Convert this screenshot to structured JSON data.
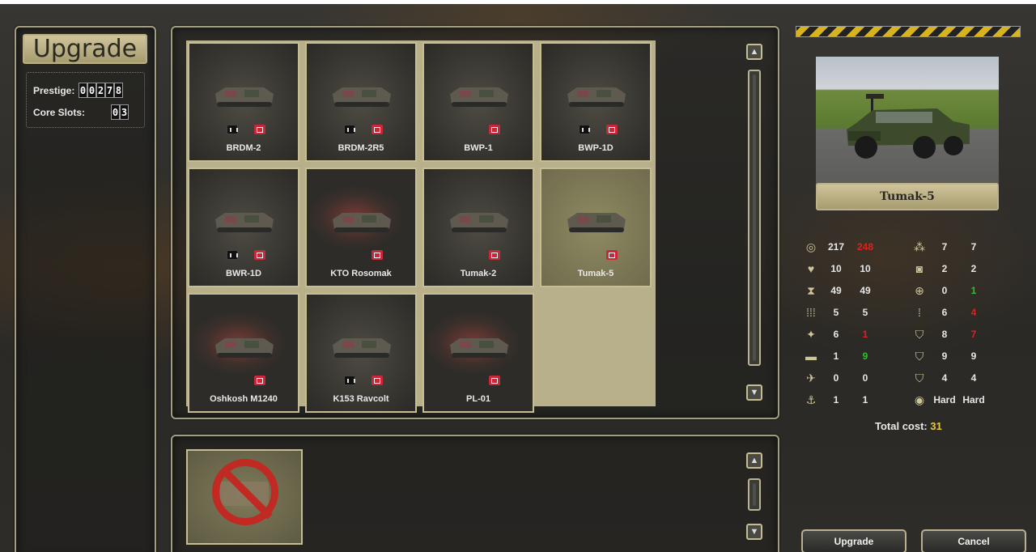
{
  "title": "Upgrade",
  "prestige": {
    "label": "Prestige:",
    "digits": [
      "0",
      "0",
      "2",
      "7",
      "8"
    ]
  },
  "core_slots": {
    "label": "Core Slots:",
    "digits": [
      "0",
      "3"
    ]
  },
  "units": [
    {
      "name": "BRDM-2",
      "binoculars": true,
      "selected": false,
      "glow": false
    },
    {
      "name": "BRDM-2R5",
      "binoculars": true,
      "selected": false,
      "glow": false
    },
    {
      "name": "BWP-1",
      "binoculars": false,
      "selected": false,
      "glow": false
    },
    {
      "name": "BWP-1D",
      "binoculars": true,
      "selected": false,
      "glow": false
    },
    {
      "name": "BWR-1D",
      "binoculars": true,
      "selected": false,
      "glow": false
    },
    {
      "name": "KTO Rosomak",
      "binoculars": false,
      "selected": false,
      "glow": true
    },
    {
      "name": "Tumak-2",
      "binoculars": false,
      "selected": false,
      "glow": false
    },
    {
      "name": "Tumak-5",
      "binoculars": false,
      "selected": true,
      "glow": false
    },
    {
      "name": "Oshkosh M1240",
      "binoculars": false,
      "selected": false,
      "glow": true
    },
    {
      "name": "K153 Ravcolt",
      "binoculars": true,
      "selected": false,
      "glow": false
    },
    {
      "name": "PL-01",
      "binoculars": false,
      "selected": false,
      "glow": true
    }
  ],
  "selected_unit": {
    "name": "Tumak-5"
  },
  "stats_left": [
    {
      "icon": "coins-icon",
      "glyph": "◎",
      "a": "217",
      "b": "248",
      "b_color": "red"
    },
    {
      "icon": "heart-icon",
      "glyph": "♥",
      "a": "10",
      "b": "10",
      "b_color": ""
    },
    {
      "icon": "hourglass-icon",
      "glyph": "⧗",
      "a": "49",
      "b": "49",
      "b_color": ""
    },
    {
      "icon": "ammo-icon",
      "glyph": "⁞⁞⁞",
      "a": "5",
      "b": "5",
      "b_color": ""
    },
    {
      "icon": "soft-attack-icon",
      "glyph": "✦",
      "a": "6",
      "b": "1",
      "b_color": "red"
    },
    {
      "icon": "hard-attack-icon",
      "glyph": "▬",
      "a": "1",
      "b": "9",
      "b_color": "green"
    },
    {
      "icon": "air-attack-icon",
      "glyph": "✈",
      "a": "0",
      "b": "0",
      "b_color": ""
    },
    {
      "icon": "naval-attack-icon",
      "glyph": "⚓",
      "a": "1",
      "b": "1",
      "b_color": ""
    }
  ],
  "stats_right": [
    {
      "icon": "movement-icon",
      "glyph": "⁂",
      "a": "7",
      "b": "7",
      "b_color": ""
    },
    {
      "icon": "spotting-icon",
      "glyph": "◙",
      "a": "2",
      "b": "2",
      "b_color": ""
    },
    {
      "icon": "range-icon",
      "glyph": "⊕",
      "a": "0",
      "b": "1",
      "b_color": "green"
    },
    {
      "icon": "initiative-icon",
      "glyph": "⁞",
      "a": "6",
      "b": "4",
      "b_color": "red"
    },
    {
      "icon": "ground-defense-icon",
      "glyph": "⛉",
      "a": "8",
      "b": "7",
      "b_color": "red"
    },
    {
      "icon": "air-defense-icon",
      "glyph": "⛉",
      "a": "9",
      "b": "9",
      "b_color": ""
    },
    {
      "icon": "close-defense-icon",
      "glyph": "⛉",
      "a": "4",
      "b": "4",
      "b_color": ""
    },
    {
      "icon": "target-type-icon",
      "glyph": "◉",
      "a": "Hard",
      "b": "Hard",
      "b_color": ""
    }
  ],
  "total_cost": {
    "label": "Total cost:",
    "value": "31"
  },
  "buttons": {
    "upgrade": "Upgrade",
    "cancel": "Cancel"
  },
  "colors": {
    "accent_gold": "#e8c840",
    "red": "#e02020",
    "green": "#2ec02e",
    "frame": "#c6bd93"
  }
}
